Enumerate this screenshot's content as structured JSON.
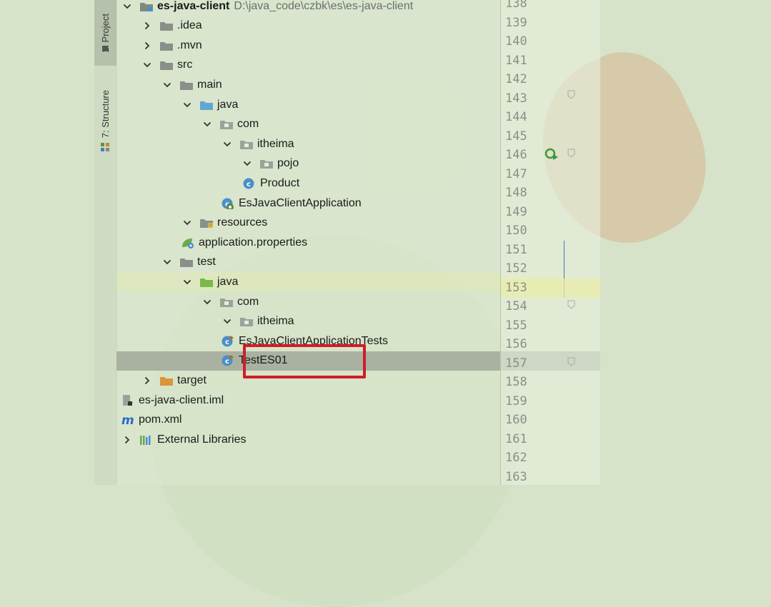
{
  "left_strip": {
    "project_tab": "1: Project",
    "structure_tab": "7: Structure"
  },
  "tree": [
    {
      "label": "es-java-client",
      "path": "D:\\java_code\\czbk\\es\\es-java-client",
      "icon": "module-folder-icon",
      "arrow": "expanded",
      "bold": true
    },
    {
      "label": ".idea",
      "icon": "folder-icon",
      "arrow": "collapsed"
    },
    {
      "label": ".mvn",
      "icon": "folder-icon",
      "arrow": "collapsed"
    },
    {
      "label": "src",
      "icon": "folder-icon",
      "arrow": "expanded"
    },
    {
      "label": "main",
      "icon": "folder-icon",
      "arrow": "expanded"
    },
    {
      "label": "java",
      "icon": "source-folder-icon",
      "arrow": "expanded"
    },
    {
      "label": "com",
      "icon": "package-icon",
      "arrow": "expanded"
    },
    {
      "label": "itheima",
      "icon": "package-icon",
      "arrow": "expanded"
    },
    {
      "label": "pojo",
      "icon": "package-icon",
      "arrow": "expanded"
    },
    {
      "label": "Product",
      "icon": "class-icon",
      "arrow": "none"
    },
    {
      "label": "EsJavaClientApplication",
      "icon": "spring-boot-class-icon",
      "arrow": "none"
    },
    {
      "label": "resources",
      "icon": "resources-folder-icon",
      "arrow": "expanded"
    },
    {
      "label": "application.properties",
      "icon": "spring-properties-icon",
      "arrow": "none"
    },
    {
      "label": "test",
      "icon": "folder-icon",
      "arrow": "expanded"
    },
    {
      "label": "java",
      "icon": "test-source-folder-icon",
      "arrow": "expanded"
    },
    {
      "label": "com",
      "icon": "package-icon",
      "arrow": "expanded"
    },
    {
      "label": "itheima",
      "icon": "package-icon",
      "arrow": "expanded"
    },
    {
      "label": "EsJavaClientApplicationTests",
      "icon": "test-class-icon",
      "arrow": "none"
    },
    {
      "label": "TestES01",
      "icon": "test-class-icon",
      "arrow": "none",
      "selected": true
    },
    {
      "label": "target",
      "icon": "excluded-folder-icon",
      "arrow": "collapsed"
    },
    {
      "label": "es-java-client.iml",
      "icon": "iml-file-icon",
      "arrow": "none"
    },
    {
      "label": "pom.xml",
      "icon": "maven-icon",
      "arrow": "none"
    },
    {
      "label": "External Libraries",
      "icon": "libraries-icon",
      "arrow": "collapsed"
    }
  ],
  "gutter": {
    "line_numbers": [
      "138",
      "139",
      "140",
      "141",
      "142",
      "143",
      "144",
      "145",
      "146",
      "147",
      "148",
      "149",
      "150",
      "151",
      "152",
      "153",
      "154",
      "155",
      "156",
      "157",
      "158",
      "159",
      "160",
      "161",
      "162",
      "163"
    ],
    "current_line": "153",
    "run_marker_line": "146"
  },
  "colors": {
    "highlight_box": "#d11c28",
    "selection": "#a9b2a0",
    "folder": "#8a8f8a",
    "source_folder": "#5fa8d3",
    "test_folder": "#79b84c",
    "excluded_folder": "#d9963a"
  }
}
